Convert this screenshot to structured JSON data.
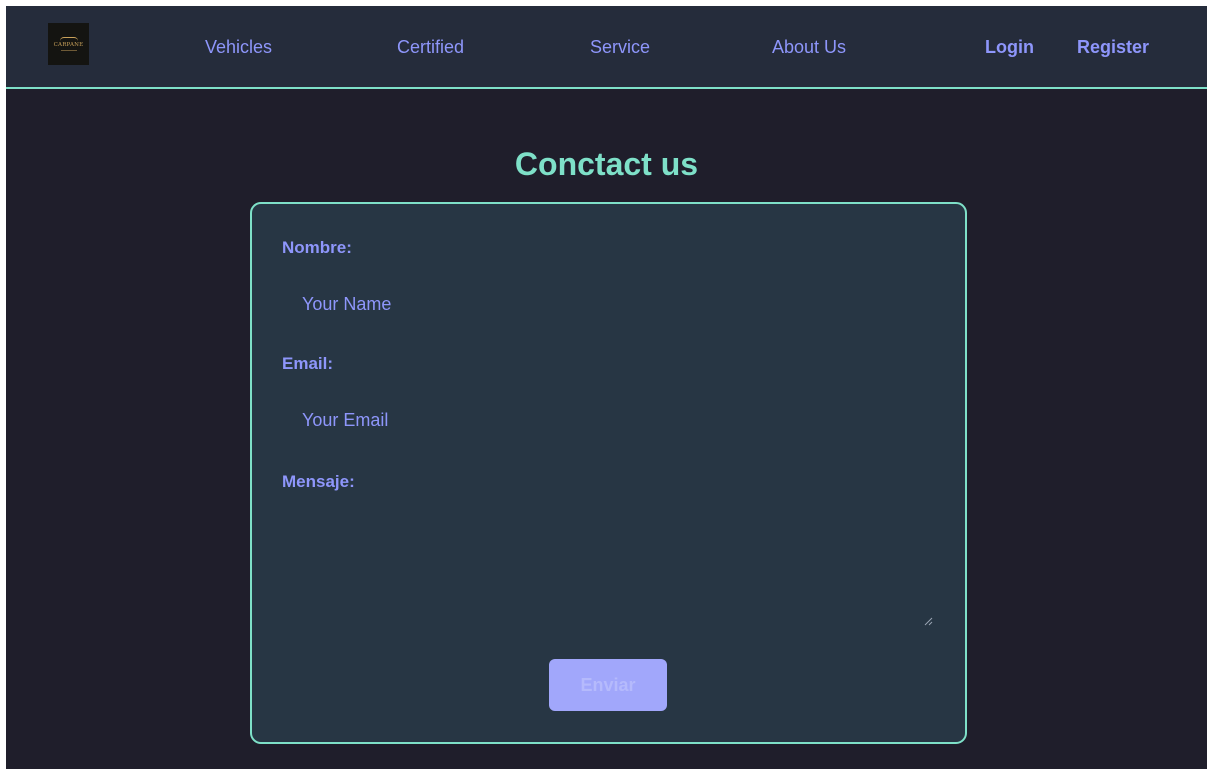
{
  "nav": {
    "logo": {
      "text": "CARPANE",
      "icon": "car-logo-icon"
    },
    "links": [
      "Vehicles",
      "Certified",
      "Service",
      "About Us"
    ],
    "login": "Login",
    "register": "Register"
  },
  "main": {
    "heading": "Conctact us",
    "form": {
      "name_label": "Nombre:",
      "name_placeholder": "Your Name",
      "email_label": "Email:",
      "email_placeholder": "Your Email",
      "message_label": "Mensaje:",
      "submit_label": "Enviar"
    }
  },
  "colors": {
    "accent": "#7ee0c8",
    "link": "#8e96fb",
    "page_bg": "#1f1e2b",
    "nav_bg": "#252c3b",
    "card_bg": "#273644",
    "button_bg": "#a1a7fb"
  }
}
